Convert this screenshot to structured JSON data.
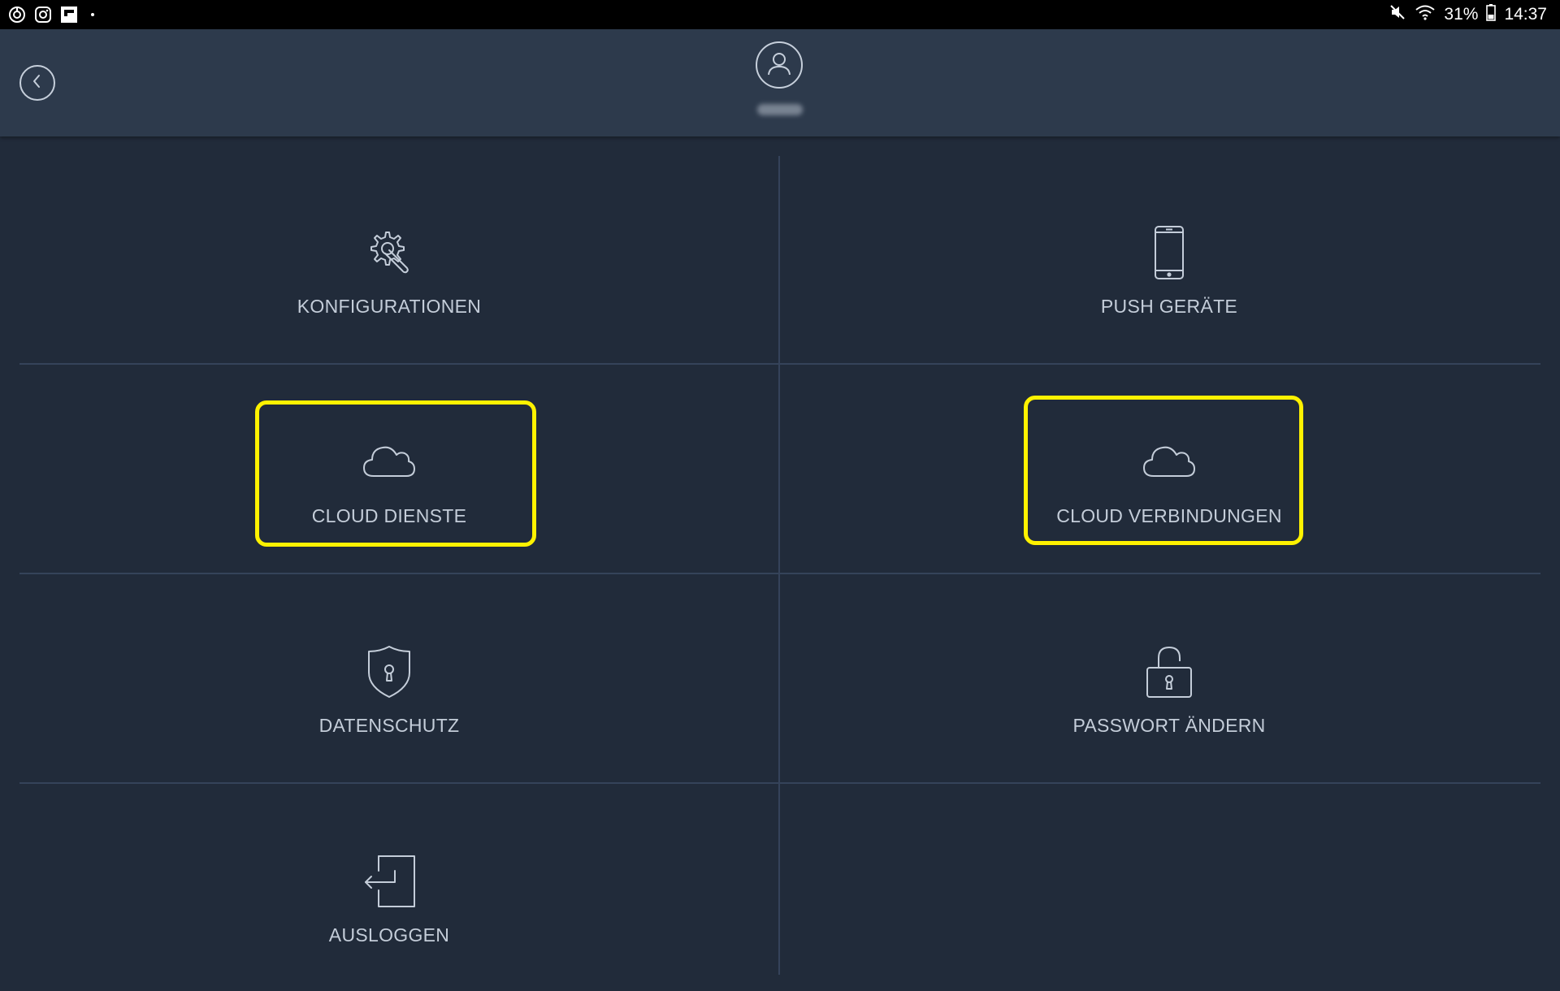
{
  "status_bar": {
    "battery_percent": "31%",
    "time": "14:37",
    "left_icons": [
      "sync-icon",
      "instagram-icon",
      "flipboard-icon",
      "notification-dot-icon"
    ],
    "right_icons": [
      "mute-icon",
      "wifi-icon",
      "battery-icon"
    ]
  },
  "header": {
    "back_icon": "chevron-left-icon",
    "avatar_icon": "user-icon"
  },
  "menu": {
    "konfigurationen": "KONFIGURATIONEN",
    "push_geraete": "PUSH GERÄTE",
    "cloud_dienste": "CLOUD DIENSTE",
    "cloud_verbindungen": "CLOUD VERBINDUNGEN",
    "datenschutz": "DATENSCHUTZ",
    "passwort_aendern": "PASSWORT ÄNDERN",
    "ausloggen": "AUSLOGGEN"
  },
  "colors": {
    "background": "#212b3a",
    "header": "#2d3a4c",
    "text": "#c4cdd9",
    "highlight": "#fff200"
  }
}
